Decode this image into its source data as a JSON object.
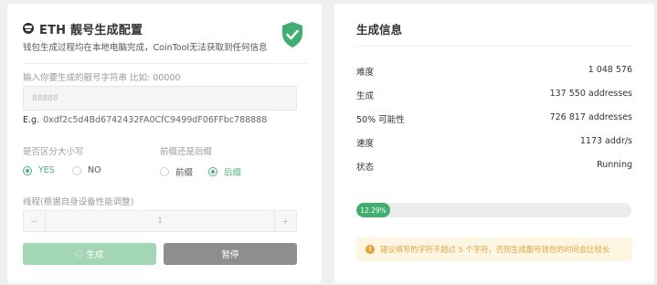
{
  "left": {
    "title": "ETH 靓号生成配置",
    "subtitle": "钱包生成过程均在本地电脑完成，CoinTool无法获取到任何信息",
    "input_label": "输入你要生成的靓号字符串 比如: 00000",
    "input_value": "88888",
    "example_prefix": "E.g.",
    "example_address": "0xdf2c5d4Bd6742432FA0CfC9499dF06FFbc788888",
    "case_label": "是否区分大小写",
    "case_options": [
      {
        "label": "YES",
        "checked": true
      },
      {
        "label": "NO",
        "checked": false
      }
    ],
    "position_label": "前缀还是后缀",
    "position_options": [
      {
        "label": "前缀",
        "checked": false
      },
      {
        "label": "后缀",
        "checked": true
      }
    ],
    "threads_label": "线程(根据自身设备性能调整)",
    "threads_minus": "−",
    "threads_value": "1",
    "threads_plus": "+",
    "generate_spinner": "◌",
    "generate_button": "生成",
    "pause_button": "暂停"
  },
  "right": {
    "title": "生成信息",
    "stats": [
      {
        "label": "难度",
        "value": "1 048 576"
      },
      {
        "label": "生成",
        "value": "137 550 addresses"
      },
      {
        "label": "50% 可能性",
        "value": "726 817 addresses"
      },
      {
        "label": "速度",
        "value": "1173 addr/s"
      },
      {
        "label": "状态",
        "value": "Running"
      }
    ],
    "progress_label": "12.29%",
    "progress_fraction": 0.1229,
    "warning_icon": "!",
    "warning_text": "建议填写的字符不超过 5 个字符，否则生成靓号钱包的时间会比较长"
  },
  "colors": {
    "accent": "#4caf7d",
    "progress": "#3fae6f",
    "warning": "#e6a23c",
    "warning_bg": "#fdf6e3",
    "pause_button": "#8e8e8e",
    "generate_button": "#a3d6b5"
  },
  "icons": {
    "title_icon": "smiley-icon",
    "verified_icon": "shield-check-icon",
    "warning_icon": "warning-icon"
  }
}
